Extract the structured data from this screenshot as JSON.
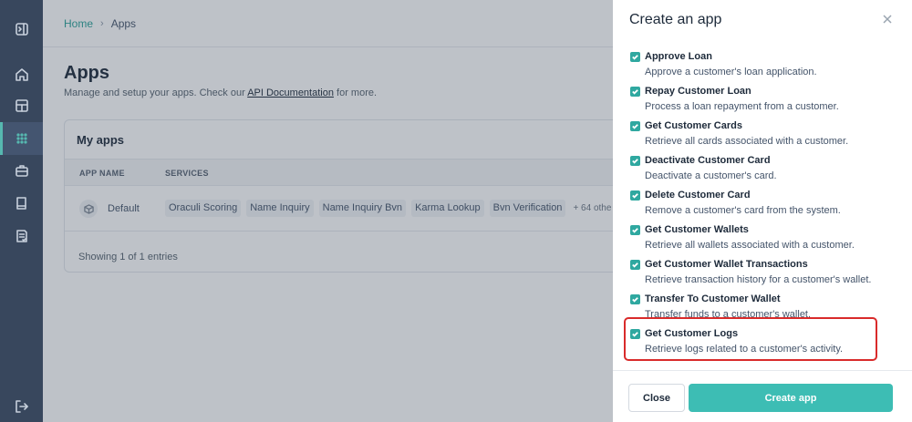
{
  "sidebar": {
    "icons": [
      "panel-toggle-icon",
      "home-icon",
      "layout-icon",
      "apps-grid-icon",
      "briefcase-icon",
      "book-icon",
      "document-icon",
      "logout-icon"
    ]
  },
  "breadcrumb": {
    "home": "Home",
    "separator": "›",
    "current": "Apps"
  },
  "page": {
    "title": "Apps",
    "subtitle_prefix": "Manage and setup your apps. Check our ",
    "subtitle_link": "API Documentation",
    "subtitle_suffix": " for more."
  },
  "my_apps": {
    "title": "My apps",
    "columns": [
      "APP NAME",
      "SERVICES"
    ],
    "rows": [
      {
        "name": "Default",
        "services": [
          "Oraculi Scoring",
          "Name Inquiry",
          "Name Inquiry Bvn",
          "Karma Lookup",
          "Bvn Verification"
        ],
        "more": "+ 64 othe"
      }
    ],
    "footer": "Showing 1 of 1 entries"
  },
  "panel": {
    "title": "Create an app",
    "items": [
      {
        "title": "Approve Loan",
        "desc": "Approve a customer's loan application.",
        "checked": true
      },
      {
        "title": "Repay Customer Loan",
        "desc": "Process a loan repayment from a customer.",
        "checked": true
      },
      {
        "title": "Get Customer Cards",
        "desc": "Retrieve all cards associated with a customer.",
        "checked": true
      },
      {
        "title": "Deactivate Customer Card",
        "desc": "Deactivate a customer's card.",
        "checked": true
      },
      {
        "title": "Delete Customer Card",
        "desc": "Remove a customer's card from the system.",
        "checked": true
      },
      {
        "title": "Get Customer Wallets",
        "desc": "Retrieve all wallets associated with a customer.",
        "checked": true
      },
      {
        "title": "Get Customer Wallet Transactions",
        "desc": "Retrieve transaction history for a customer's wallet.",
        "checked": true
      },
      {
        "title": "Transfer To Customer Wallet",
        "desc": "Transfer funds to a customer's wallet.",
        "checked": true
      },
      {
        "title": "Get Customer Logs",
        "desc": "Retrieve logs related to a customer's activity.",
        "checked": true
      }
    ],
    "close_label": "Close",
    "create_label": "Create app"
  },
  "colors": {
    "accent": "#3dbdb4",
    "sidebar": "#38475d",
    "highlight": "#d92b2b"
  }
}
